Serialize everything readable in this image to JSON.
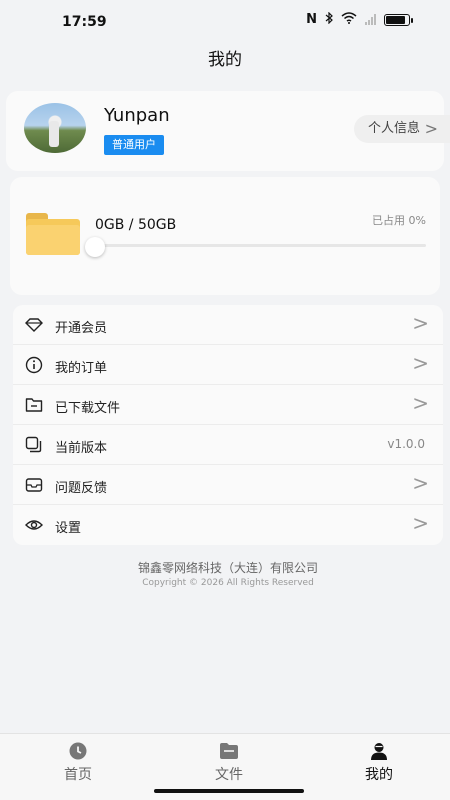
{
  "status_bar": {
    "time": "17:59"
  },
  "header": {
    "title": "我的"
  },
  "profile": {
    "username": "Yunpan",
    "badge": "普通用户",
    "link_label": "个人信息",
    "chevron": ">"
  },
  "storage": {
    "usage": "0GB / 50GB",
    "used_label": "已占用 0%",
    "used_fraction": 0
  },
  "menu": {
    "items": [
      {
        "label": "开通会员",
        "icon": "diamond-icon",
        "chevron": ">"
      },
      {
        "label": "我的订单",
        "icon": "info-icon",
        "chevron": ">"
      },
      {
        "label": "已下载文件",
        "icon": "folder-icon",
        "chevron": ">"
      },
      {
        "label": "当前版本",
        "icon": "version-icon",
        "value": "v1.0.0"
      },
      {
        "label": "问题反馈",
        "icon": "inbox-icon",
        "chevron": ">"
      },
      {
        "label": "设置",
        "icon": "eye-icon",
        "chevron": ">"
      }
    ]
  },
  "footer": {
    "company": "锦鑫零网络科技（大连）有限公司",
    "copyright": "Copyright © 2026 All Rights Reserved"
  },
  "tabs": [
    {
      "label": "首页",
      "icon": "clock-icon",
      "active": false
    },
    {
      "label": "文件",
      "icon": "files-icon",
      "active": false
    },
    {
      "label": "我的",
      "icon": "user-icon",
      "active": true
    }
  ],
  "colors": {
    "accent": "#1a8cf0",
    "folder": "#f6c95a"
  }
}
